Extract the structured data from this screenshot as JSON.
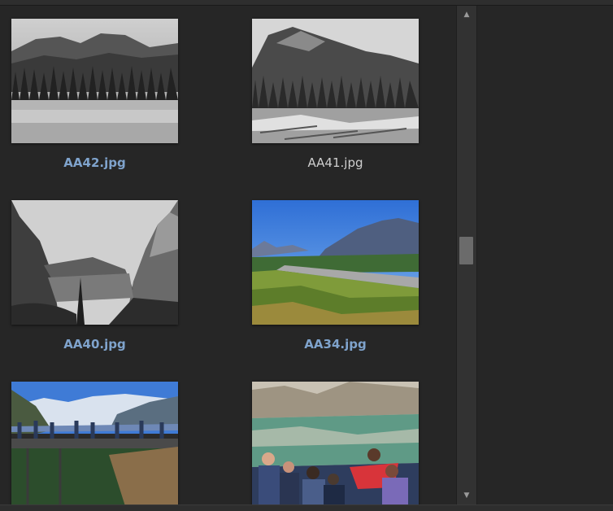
{
  "thumbnails": [
    {
      "filename": "AA42.jpg",
      "selected": true,
      "icon": "photo-bw-mountain-forest-meadow"
    },
    {
      "filename": "AA41.jpg",
      "selected": false,
      "icon": "photo-bw-mountain-driftwood"
    },
    {
      "filename": "AA40.jpg",
      "selected": true,
      "icon": "photo-bw-lake-valley"
    },
    {
      "filename": "AA34.jpg",
      "selected": true,
      "icon": "photo-color-mountain-road"
    },
    {
      "filename": "",
      "selected": false,
      "icon": "photo-color-skywalk-glacier"
    },
    {
      "filename": "",
      "selected": false,
      "icon": "photo-color-lake-people"
    }
  ],
  "scrollbar": {
    "up_icon": "▲",
    "down_icon": "▼",
    "position_fraction": 0.49
  },
  "colors": {
    "background": "#262626",
    "selected_caption": "#7fa3cc",
    "normal_caption": "#cfcfcf",
    "scroll_thumb": "#6b6b6b"
  }
}
